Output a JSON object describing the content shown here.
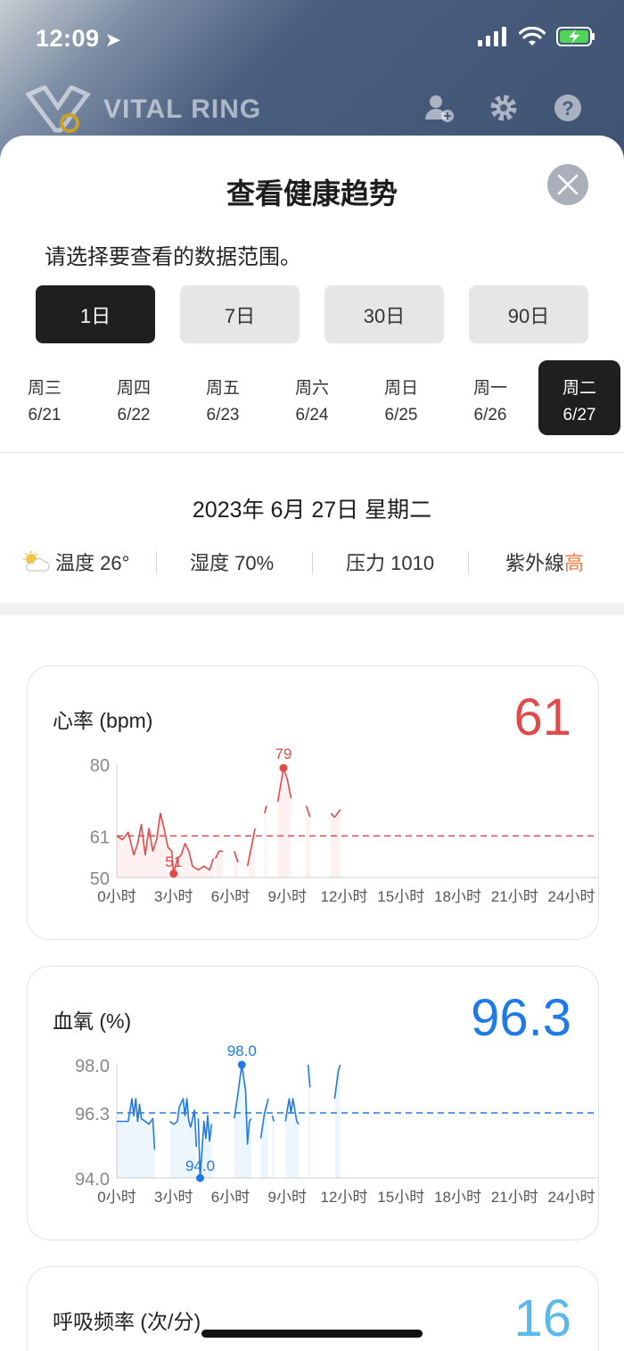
{
  "status": {
    "time": "12:09"
  },
  "app": {
    "brand": "VITAL RING"
  },
  "sheet": {
    "title": "查看健康趋势",
    "prompt": "请选择要查看的数据范围。",
    "ranges": [
      "1日",
      "7日",
      "30日",
      "90日"
    ],
    "selected_range": "1日",
    "days": [
      {
        "weekday": "周三",
        "date": "6/21"
      },
      {
        "weekday": "周四",
        "date": "6/22"
      },
      {
        "weekday": "周五",
        "date": "6/23"
      },
      {
        "weekday": "周六",
        "date": "6/24"
      },
      {
        "weekday": "周日",
        "date": "6/25"
      },
      {
        "weekday": "周一",
        "date": "6/26"
      },
      {
        "weekday": "周二",
        "date": "6/27"
      }
    ],
    "selected_day": "6/27",
    "full_date": "2023年 6月 27日 星期二",
    "weather": {
      "temp": "温度 26°",
      "humidity": "湿度 70%",
      "pressure": "压力 1010",
      "uv_label": "紫外線",
      "uv_value": "高"
    }
  },
  "colors": {
    "heart": "#e24a4a",
    "spo2": "#1f7ae8",
    "resp": "#5bb8ea"
  },
  "cards": {
    "heart": {
      "title": "心率 (bpm)",
      "value": "61"
    },
    "spo2": {
      "title": "血氧 (%)",
      "value": "96.3"
    },
    "resp": {
      "title": "呼吸频率 (次/分)",
      "value": "16"
    }
  },
  "chart_data": [
    {
      "type": "line",
      "title": "心率 (bpm)",
      "xlabel": "",
      "ylabel": "",
      "x_ticks": [
        "0小时",
        "3小时",
        "6小时",
        "9小时",
        "12小时",
        "15小时",
        "18小时",
        "21小时",
        "24小时"
      ],
      "y_ticks": [
        "80",
        "61",
        "50"
      ],
      "xlim": [
        0,
        24
      ],
      "ylim": [
        50,
        80
      ],
      "average": 61,
      "max_label": {
        "x": 8.8,
        "y": 79,
        "text": "79"
      },
      "min_label": {
        "x": 3.0,
        "y": 51,
        "text": "51"
      },
      "segments": [
        [
          [
            0,
            61
          ],
          [
            0.3,
            60
          ],
          [
            0.6,
            62
          ],
          [
            0.9,
            56
          ],
          [
            1.1,
            59
          ],
          [
            1.3,
            64
          ],
          [
            1.5,
            56
          ],
          [
            1.7,
            63
          ],
          [
            1.9,
            57
          ],
          [
            2.1,
            60
          ],
          [
            2.3,
            67
          ],
          [
            2.5,
            63
          ],
          [
            2.7,
            58
          ],
          [
            2.9,
            57
          ],
          [
            3.0,
            51
          ],
          [
            3.2,
            55
          ],
          [
            3.4,
            56
          ],
          [
            3.6,
            59
          ],
          [
            3.8,
            57
          ],
          [
            4.0,
            53
          ],
          [
            4.3,
            52
          ],
          [
            4.6,
            53
          ],
          [
            4.9,
            52
          ],
          [
            5.1,
            55
          ]
        ],
        [
          [
            5.2,
            55
          ],
          [
            5.4,
            57
          ],
          [
            5.6,
            57
          ]
        ],
        [
          [
            6.2,
            57
          ],
          [
            6.4,
            54
          ]
        ],
        [
          [
            6.9,
            53
          ],
          [
            7.1,
            58
          ],
          [
            7.3,
            63
          ]
        ],
        [
          [
            7.8,
            67
          ],
          [
            7.9,
            69
          ]
        ],
        [
          [
            8.5,
            70
          ],
          [
            8.7,
            76
          ],
          [
            8.8,
            79
          ],
          [
            9.0,
            76
          ],
          [
            9.2,
            71
          ]
        ],
        [
          [
            10.0,
            69
          ],
          [
            10.2,
            66
          ]
        ],
        [
          [
            11.3,
            67
          ],
          [
            11.5,
            66
          ],
          [
            11.8,
            68
          ]
        ]
      ]
    },
    {
      "type": "line",
      "title": "血氧 (%)",
      "xlabel": "",
      "ylabel": "",
      "x_ticks": [
        "0小时",
        "3小时",
        "6小时",
        "9小时",
        "12小时",
        "15小时",
        "18小时",
        "21小时",
        "24小时"
      ],
      "y_ticks": [
        "98.0",
        "96.3",
        "94.0"
      ],
      "xlim": [
        0,
        24
      ],
      "ylim": [
        94,
        98
      ],
      "average": 96.3,
      "max_label": {
        "x": 6.6,
        "y": 98.0,
        "text": "98.0"
      },
      "min_label": {
        "x": 4.4,
        "y": 94.0,
        "text": "94.0"
      },
      "segments": [
        [
          [
            0,
            96
          ],
          [
            0.3,
            96
          ],
          [
            0.6,
            96
          ],
          [
            0.8,
            96.8
          ],
          [
            0.9,
            96.2
          ],
          [
            1.0,
            96.8
          ],
          [
            1.1,
            96.0
          ],
          [
            1.2,
            96.6
          ],
          [
            1.3,
            96.1
          ],
          [
            1.5,
            96.0
          ],
          [
            1.7,
            95.9
          ],
          [
            1.9,
            96.1
          ],
          [
            2.0,
            95.0
          ]
        ],
        [
          [
            2.8,
            96.0
          ],
          [
            3.0,
            95.9
          ],
          [
            3.2,
            96.0
          ],
          [
            3.3,
            96.5
          ],
          [
            3.5,
            96.8
          ],
          [
            3.6,
            96.2
          ],
          [
            3.7,
            96.8
          ],
          [
            3.8,
            96.0
          ],
          [
            3.9,
            95.8
          ],
          [
            4.1,
            96.4
          ],
          [
            4.2,
            95.1
          ]
        ],
        [
          [
            4.3,
            96.1
          ],
          [
            4.4,
            94.0
          ],
          [
            4.6,
            96.0
          ],
          [
            4.7,
            95.4
          ],
          [
            4.8,
            96.2
          ],
          [
            4.9,
            95.3
          ],
          [
            5.0,
            95.9
          ]
        ],
        [
          [
            6.2,
            96.1
          ],
          [
            6.4,
            97.0
          ],
          [
            6.6,
            98.0
          ],
          [
            6.8,
            97.1
          ],
          [
            6.9,
            95.2
          ],
          [
            7.0,
            96.0
          ],
          [
            7.1,
            96.1
          ]
        ],
        [
          [
            7.6,
            95.4
          ],
          [
            7.8,
            96.3
          ],
          [
            8.0,
            96.8
          ]
        ],
        [
          [
            8.2,
            96.2
          ],
          [
            8.3,
            96.0
          ]
        ],
        [
          [
            8.9,
            96.0
          ],
          [
            9.1,
            96.8
          ],
          [
            9.2,
            96.3
          ],
          [
            9.3,
            96.8
          ],
          [
            9.5,
            96.0
          ],
          [
            9.6,
            95.9
          ]
        ],
        [
          [
            10.1,
            98.0
          ],
          [
            10.2,
            97.2
          ]
        ],
        [
          [
            11.5,
            96.8
          ],
          [
            11.7,
            97.8
          ],
          [
            11.8,
            98.0
          ]
        ]
      ]
    }
  ]
}
